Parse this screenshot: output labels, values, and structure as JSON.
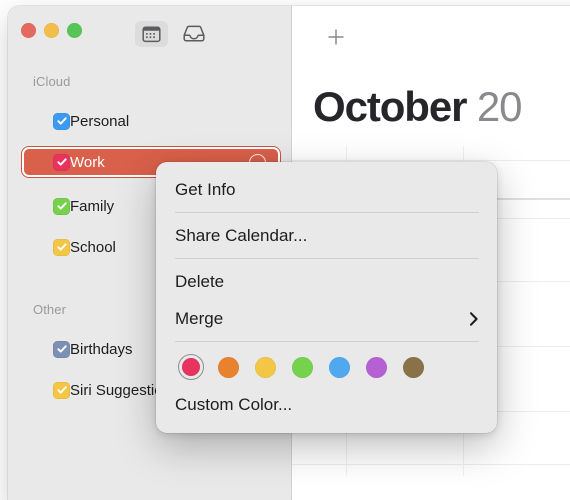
{
  "window": {
    "traffic_lights": [
      {
        "name": "close",
        "color": "#e4695e"
      },
      {
        "name": "minimize",
        "color": "#f2bd48"
      },
      {
        "name": "zoom",
        "color": "#57c555"
      }
    ]
  },
  "toolbar": {
    "calendar_view_icon": "calendar-icon",
    "inbox_icon": "inbox-icon",
    "add_icon": "plus-icon"
  },
  "sidebar": {
    "sections": [
      {
        "header": "iCloud",
        "items": [
          {
            "label": "Personal",
            "color": "#3c9bf0",
            "checked": true,
            "selected": false
          },
          {
            "label": "Work",
            "color": "#e9335f",
            "checked": true,
            "selected": true
          },
          {
            "label": "Family",
            "color": "#76d14c",
            "checked": true,
            "selected": false
          },
          {
            "label": "School",
            "color": "#f3c council",
            "checked": true,
            "selected": false
          }
        ]
      },
      {
        "header": "Other",
        "items": [
          {
            "label": "Birthdays",
            "color": "#7c90b4",
            "checked": true,
            "selected": false
          },
          {
            "label": "Siri Suggestions",
            "color": "#f3c646",
            "checked": true,
            "selected": false
          }
        ]
      }
    ]
  },
  "main": {
    "month": "October",
    "year": "20"
  },
  "context_menu": {
    "items": [
      {
        "label": "Get Info",
        "has_submenu": false
      },
      {
        "label": "Share Calendar...",
        "has_submenu": false
      },
      {
        "label": "Delete",
        "has_submenu": false
      },
      {
        "label": "Merge",
        "has_submenu": true
      }
    ],
    "colors": [
      {
        "name": "red",
        "hex": "#e9335f",
        "selected": true
      },
      {
        "name": "orange",
        "hex": "#e8822e",
        "selected": false
      },
      {
        "name": "yellow",
        "hex": "#f3c646",
        "selected": false
      },
      {
        "name": "green",
        "hex": "#76d14c",
        "selected": false
      },
      {
        "name": "blue",
        "hex": "#50a8f0",
        "selected": false
      },
      {
        "name": "purple",
        "hex": "#b濃561d4",
        "selected": false
      },
      {
        "name": "brown",
        "hex": "#8a7248",
        "selected": false
      }
    ],
    "custom_color_label": "Custom Color..."
  }
}
